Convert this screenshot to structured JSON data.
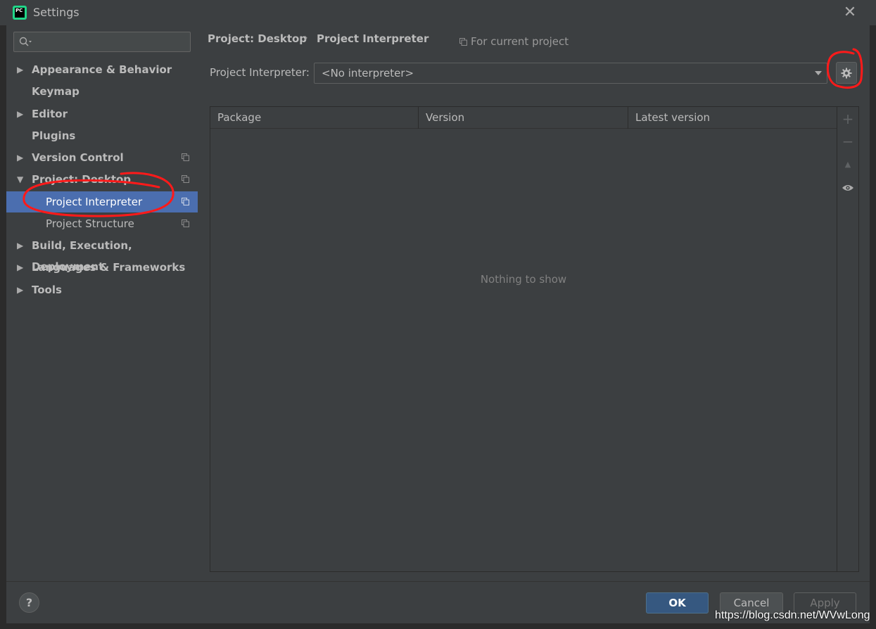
{
  "window": {
    "title": "Settings",
    "app_logo_text": "PC"
  },
  "search": {
    "placeholder": ""
  },
  "sidebar": {
    "items": [
      {
        "label": "Appearance & Behavior",
        "expandable": true,
        "expanded": false
      },
      {
        "label": "Keymap",
        "expandable": false
      },
      {
        "label": "Editor",
        "expandable": true,
        "expanded": false
      },
      {
        "label": "Plugins",
        "expandable": false
      },
      {
        "label": "Version Control",
        "expandable": true,
        "expanded": false
      },
      {
        "label": "Project: Desktop",
        "expandable": true,
        "expanded": true
      },
      {
        "label": "Project Interpreter",
        "child": true,
        "selected": true
      },
      {
        "label": "Project Structure",
        "child": true
      },
      {
        "label": "Build, Execution, Deployment",
        "expandable": true,
        "expanded": false
      },
      {
        "label": "Languages & Frameworks",
        "expandable": true,
        "expanded": false
      },
      {
        "label": "Tools",
        "expandable": true,
        "expanded": false
      }
    ]
  },
  "main": {
    "breadcrumb": [
      "Project: Desktop",
      "Project Interpreter"
    ],
    "breadcrumb_separator": "›",
    "scope_label": "For current project",
    "interpreter_label": "Project Interpreter:",
    "interpreter_value": "<No interpreter>",
    "table": {
      "columns": [
        "Package",
        "Version",
        "Latest version"
      ],
      "empty_text": "Nothing to show"
    },
    "toolbar": {
      "add": "+",
      "remove": "−",
      "upgrade": "▲"
    }
  },
  "footer": {
    "help": "?",
    "ok": "OK",
    "cancel": "Cancel",
    "apply": "Apply"
  },
  "watermark": "https://blog.csdn.net/WVwLong",
  "colors": {
    "background": "#3c3f41",
    "selection": "#4b6eaf",
    "ok_button": "#365880",
    "annotation": "#ff0000"
  }
}
